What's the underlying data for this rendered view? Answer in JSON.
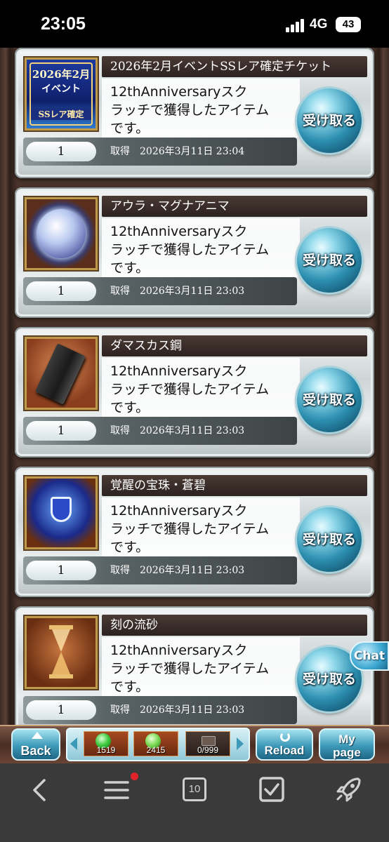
{
  "status_bar": {
    "time": "23:05",
    "network": "4G",
    "battery": "43"
  },
  "items": [
    {
      "name": "2026年2月イベントSSレア確定チケット",
      "description_line1": "12thAnniversaryスク",
      "description_line2": "ラッチで獲得したアイテム",
      "description_line3": "です。",
      "quantity": "1",
      "acquired_label": "取得",
      "acquired_time": "2026年3月11日 23:04",
      "button_label": "受け取る",
      "thumb_kind": "ticket",
      "thumb_text_line1": "2026年2月",
      "thumb_text_line2": "イベント",
      "thumb_text_line3": "SSレア確定"
    },
    {
      "name": "アウラ・マグナアニマ",
      "description_line1": "12thAnniversaryスク",
      "description_line2": "ラッチで獲得したアイテム",
      "description_line3": "です。",
      "quantity": "1",
      "acquired_label": "取得",
      "acquired_time": "2026年3月11日 23:03",
      "button_label": "受け取る",
      "thumb_kind": "anima"
    },
    {
      "name": "ダマスカス鋼",
      "description_line1": "12thAnniversaryスク",
      "description_line2": "ラッチで獲得したアイテム",
      "description_line3": "です。",
      "quantity": "1",
      "acquired_label": "取得",
      "acquired_time": "2026年3月11日 23:03",
      "button_label": "受け取る",
      "thumb_kind": "ingot"
    },
    {
      "name": "覚醒の宝珠・蒼碧",
      "description_line1": "12thAnniversaryスク",
      "description_line2": "ラッチで獲得したアイテム",
      "description_line3": "です。",
      "quantity": "1",
      "acquired_label": "取得",
      "acquired_time": "2026年3月11日 23:03",
      "button_label": "受け取る",
      "thumb_kind": "orb"
    },
    {
      "name": "刻の流砂",
      "description_line1": "12thAnniversaryスク",
      "description_line2": "ラッチで獲得したアイテム",
      "description_line3": "です。",
      "quantity": "1",
      "acquired_label": "取得",
      "acquired_time": "2026年3月11日 23:03",
      "button_label": "受け取る",
      "thumb_kind": "hourglass"
    }
  ],
  "chat_label": "Chat",
  "game_bar": {
    "back_label": "Back",
    "reload_label": "Reload",
    "mypage_line1": "My",
    "mypage_line2": "page",
    "resources": [
      {
        "value": "1519",
        "icon": "green-orb-icon"
      },
      {
        "value": "2415",
        "icon": "green-leaf-icon"
      },
      {
        "value": "0/999",
        "icon": "card-icon"
      }
    ]
  },
  "browser_nav": {
    "tab_count": "10",
    "items": [
      "back-icon",
      "menu-icon",
      "tabs-icon",
      "checklist-icon",
      "rocket-icon"
    ]
  },
  "colors": {
    "accent_button": "#2d8fb0",
    "title_bar": "#2c2220",
    "notification_dot": "#e0242a"
  }
}
